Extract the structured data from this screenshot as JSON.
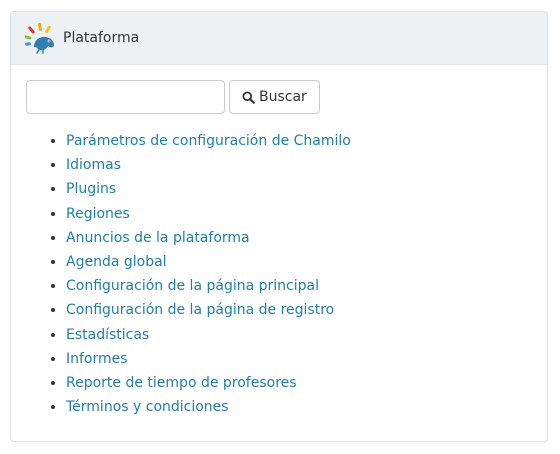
{
  "panel": {
    "title": "Plataforma",
    "logo_icon": "chamilo-logo-icon"
  },
  "search": {
    "value": "",
    "placeholder": "",
    "button_label": "Buscar",
    "button_icon": "search-icon"
  },
  "links": [
    {
      "label": "Parámetros de configuración de Chamilo"
    },
    {
      "label": "Idiomas"
    },
    {
      "label": "Plugins"
    },
    {
      "label": "Regiones"
    },
    {
      "label": "Anuncios de la plataforma"
    },
    {
      "label": "Agenda global"
    },
    {
      "label": "Configuración de la página principal"
    },
    {
      "label": "Configuración de la página de registro"
    },
    {
      "label": "Estadísticas"
    },
    {
      "label": "Informes"
    },
    {
      "label": "Reporte de tiempo de profesores"
    },
    {
      "label": "Términos y condiciones"
    }
  ],
  "colors": {
    "link": "#1f7faa",
    "header_bg": "#eef1f4"
  }
}
